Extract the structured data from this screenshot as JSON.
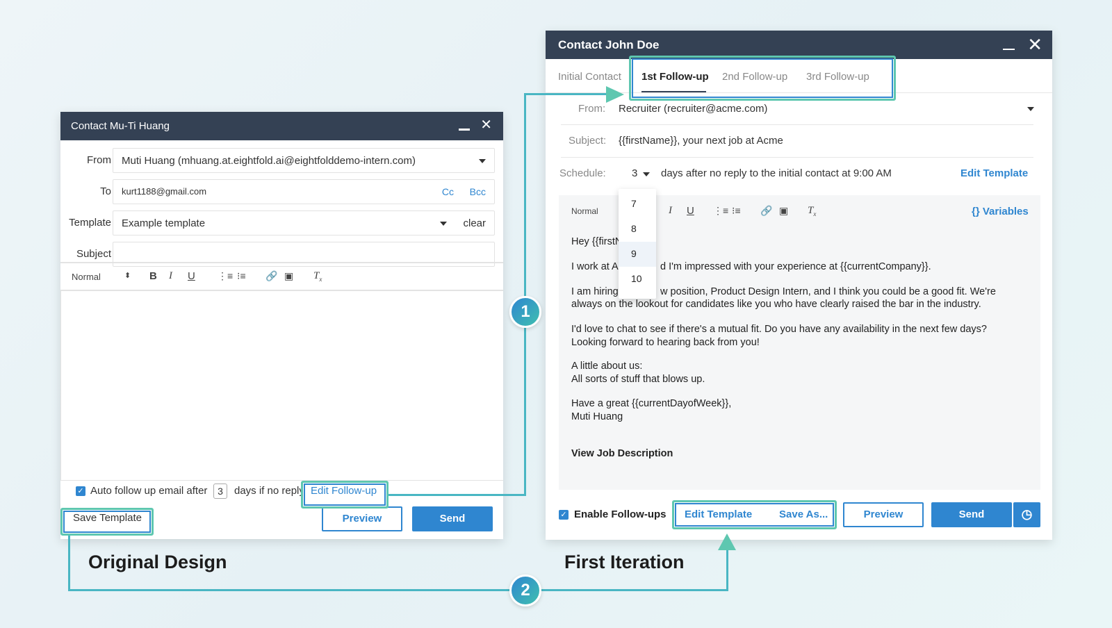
{
  "original": {
    "window_title": "Contact Mu-Ti Huang",
    "caption": "Original Design",
    "from_label": "From",
    "from_value": "Muti Huang (mhuang.at.eightfold.ai@eightfolddemo-intern.com)",
    "to_label": "To",
    "to_value": "kurt1188@gmail.com",
    "cc_label": "Cc",
    "bcc_label": "Bcc",
    "template_label": "Template",
    "template_value": "Example template",
    "template_clear": "clear",
    "subject_label": "Subject",
    "subject_value": "",
    "toolbar_style": "Normal",
    "auto_follow_label": "Auto follow up email after",
    "auto_follow_days": "3",
    "auto_follow_suffix": "days if no reply",
    "edit_followup": "Edit Follow-up",
    "save_template": "Save Template",
    "preview": "Preview",
    "send": "Send"
  },
  "iteration": {
    "window_title": "Contact John Doe",
    "caption": "First Iteration",
    "tabs": [
      "Initial Contact",
      "1st Follow-up",
      "2nd Follow-up",
      "3rd Follow-up"
    ],
    "active_tab": "1st Follow-up",
    "from_label": "From:",
    "from_value": "Recruiter (recruiter@acme.com)",
    "subject_label": "Subject:",
    "subject_value": "{{firstName}}, your next job at Acme",
    "schedule_label": "Schedule:",
    "schedule_days": "3",
    "schedule_text": "days after no reply to the initial contact at 9:00 AM",
    "edit_template_link": "Edit Template",
    "toolbar_style": "Normal",
    "variables": "{} Variables",
    "day_options": [
      "7",
      "8",
      "9",
      "10"
    ],
    "highlighted_option": "9",
    "body": {
      "greeting": "Hey {{firstN",
      "p1a": "I work at A",
      "p1b": "d I'm impressed with your experience at {{currentCompany}}.",
      "p2a": "I am hiring",
      "p2b": "w position, Product Design Intern, and I think you could be a good fit. We're",
      "p2c": "always on the lookout for candidates like you who have clearly raised the bar in the industry.",
      "p3": "I'd love to chat to see if there's a mutual fit. Do you have any availability in the next few days?\nLooking forward to hearing back from you!",
      "p4": "A little about us:\nAll sorts of stuff that blows up.",
      "p5": "Have a great {{currentDayofWeek}},\nMuti Huang",
      "job_link": "View Job Description"
    },
    "enable_followups": "Enable Follow-ups",
    "edit_template": "Edit Template",
    "save_as": "Save As...",
    "preview": "Preview",
    "send": "Send"
  },
  "annotations": {
    "step1": "1",
    "step2": "2"
  },
  "colors": {
    "titlebar": "#344154",
    "accent": "#2f86d0",
    "highlight": "#5ec7b0",
    "connector": "#49b6c3"
  }
}
